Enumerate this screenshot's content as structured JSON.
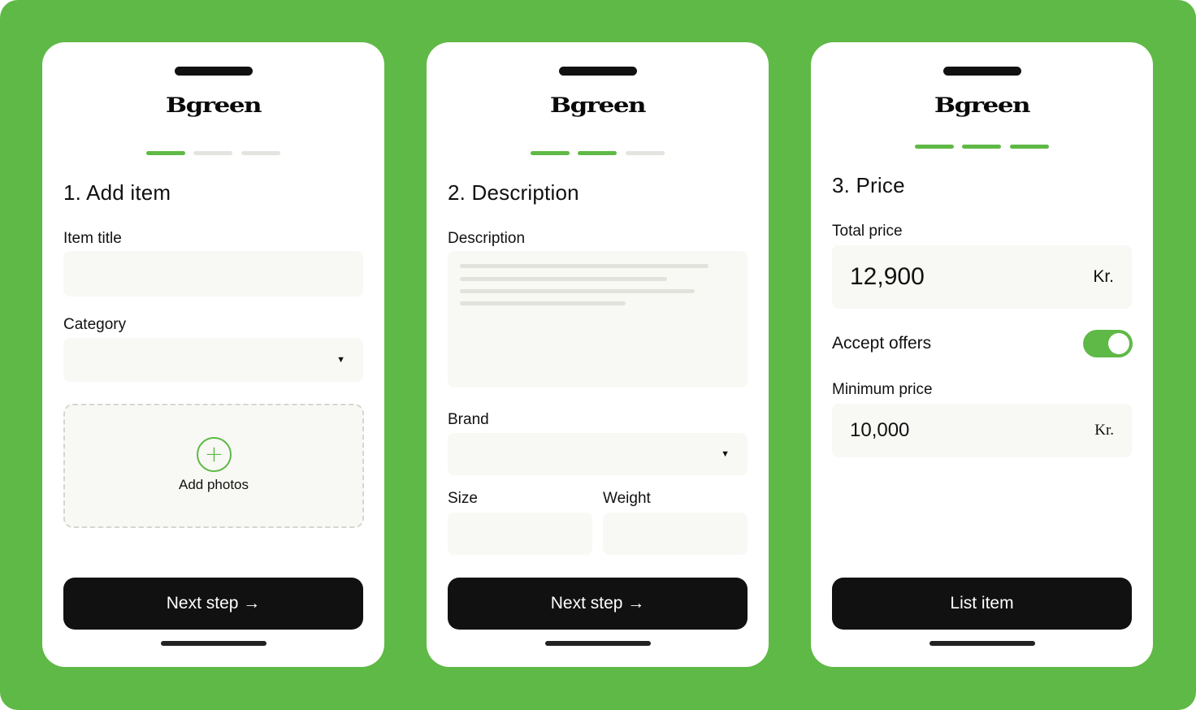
{
  "colors": {
    "brand_green": "#5fb946",
    "button_dark": "#111111",
    "field_bg": "#f8f8f5"
  },
  "screens": [
    {
      "logo": "Bgreen",
      "progress": {
        "total": 3,
        "completed": 1
      },
      "title": "1. Add item",
      "item_title": {
        "label": "Item title",
        "value": ""
      },
      "category": {
        "label": "Category",
        "value": "",
        "caret_icon": "caret-down-icon"
      },
      "photos": {
        "label": "Add photos",
        "icon": "plus-circle-icon"
      },
      "button": {
        "label": "Next step →"
      }
    },
    {
      "logo": "Bgreen",
      "progress": {
        "total": 3,
        "completed": 2
      },
      "title": "2. Description",
      "description": {
        "label": "Description"
      },
      "brand": {
        "label": "Brand",
        "value": "",
        "caret_icon": "caret-down-icon"
      },
      "size": {
        "label": "Size",
        "value": ""
      },
      "weight": {
        "label": "Weight",
        "value": ""
      },
      "button": {
        "label": "Next step →"
      }
    },
    {
      "logo": "Bgreen",
      "progress": {
        "total": 3,
        "completed": 3
      },
      "title": "3. Price",
      "total_price": {
        "label": "Total price",
        "value": "12,900",
        "unit": "Kr."
      },
      "accept_offers": {
        "label": "Accept offers",
        "enabled": true
      },
      "minimum_price": {
        "label": "Minimum price",
        "value": "10,000",
        "unit": "Kr."
      },
      "button": {
        "label": "List item"
      }
    }
  ]
}
